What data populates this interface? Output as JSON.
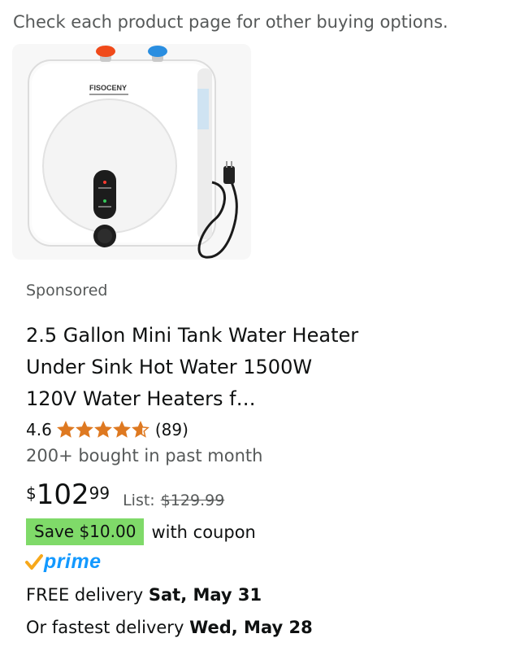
{
  "notice": "Check each product page for other buying options.",
  "product": {
    "image_alt": "FISOCENY mini tank water heater",
    "brand_on_image": "FISOCENY",
    "sponsored_label": "Sponsored",
    "title": "2.5 Gallon Mini Tank Water Heater Under Sink Hot Water 1500W 120V Water Heaters f…",
    "rating": "4.6",
    "rating_value": 4.6,
    "rating_max": 5,
    "review_count": "(89)",
    "bought": "200+ bought in past month",
    "price": {
      "symbol": "$",
      "whole": "102",
      "fraction": "99",
      "list_label": "List:",
      "list_price": "$129.99"
    },
    "coupon": {
      "badge": "Save $10.00",
      "text": "with coupon",
      "color": "#7fda69"
    },
    "prime": {
      "icon": "prime-check-icon",
      "label": "prime",
      "color": "#1399ff"
    },
    "delivery": {
      "free_prefix": "FREE delivery ",
      "free_date": "Sat, May 31",
      "fast_prefix": "Or fastest delivery ",
      "fast_date": "Wed, May 28"
    }
  },
  "colors": {
    "star": "#de7921",
    "text": "#0f1111",
    "secondary": "#565959"
  }
}
